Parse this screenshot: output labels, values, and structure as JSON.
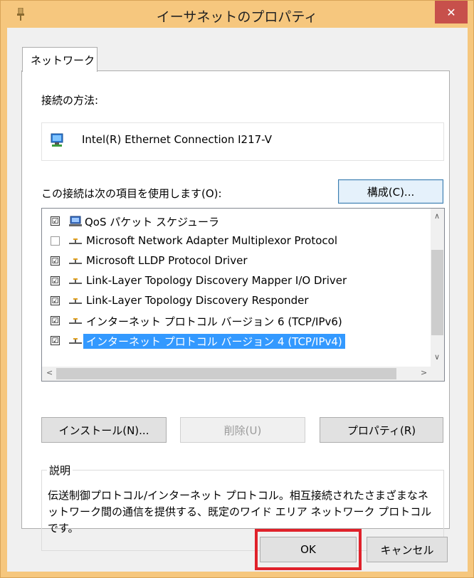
{
  "window": {
    "title": "イーサネットのプロパティ",
    "close_glyph": "✕"
  },
  "tabs": [
    {
      "label": "ネットワーク"
    }
  ],
  "connection": {
    "label": "接続の方法:",
    "adapter": "Intel(R) Ethernet Connection I217-V",
    "configure_button": "構成(C)..."
  },
  "items_label": "この接続は次の項目を使用します(O):",
  "items": [
    {
      "label": "QoS パケット スケジューラ",
      "checked": "☑",
      "icon": "network-service-icon"
    },
    {
      "label": "Microsoft Network Adapter Multiplexor Protocol",
      "checked": "",
      "icon": "protocol-icon"
    },
    {
      "label": "Microsoft LLDP Protocol Driver",
      "checked": "☑",
      "icon": "protocol-icon"
    },
    {
      "label": "Link-Layer Topology Discovery Mapper I/O Driver",
      "checked": "☑",
      "icon": "protocol-icon"
    },
    {
      "label": "Link-Layer Topology Discovery Responder",
      "checked": "☑",
      "icon": "protocol-icon"
    },
    {
      "label": "インターネット プロトコル バージョン 6 (TCP/IPv6)",
      "checked": "☑",
      "icon": "protocol-icon"
    },
    {
      "label": "インターネット プロトコル バージョン 4 (TCP/IPv4)",
      "checked": "☑",
      "icon": "protocol-icon",
      "selected": true
    }
  ],
  "buttons": {
    "install": "インストール(N)...",
    "uninstall": "削除(U)",
    "properties": "プロパティ(R)",
    "ok": "OK",
    "cancel": "キャンセル"
  },
  "description": {
    "legend": "説明",
    "text": "伝送制御プロトコル/インターネット プロトコル。相互接続されたさまざまなネットワーク間の通信を提供する、既定のワイド エリア ネットワーク プロトコルです。"
  },
  "colors": {
    "frame": "#f6c77e",
    "close": "#c7504b",
    "selection": "#3399ff",
    "annotation": "#e0212a"
  }
}
